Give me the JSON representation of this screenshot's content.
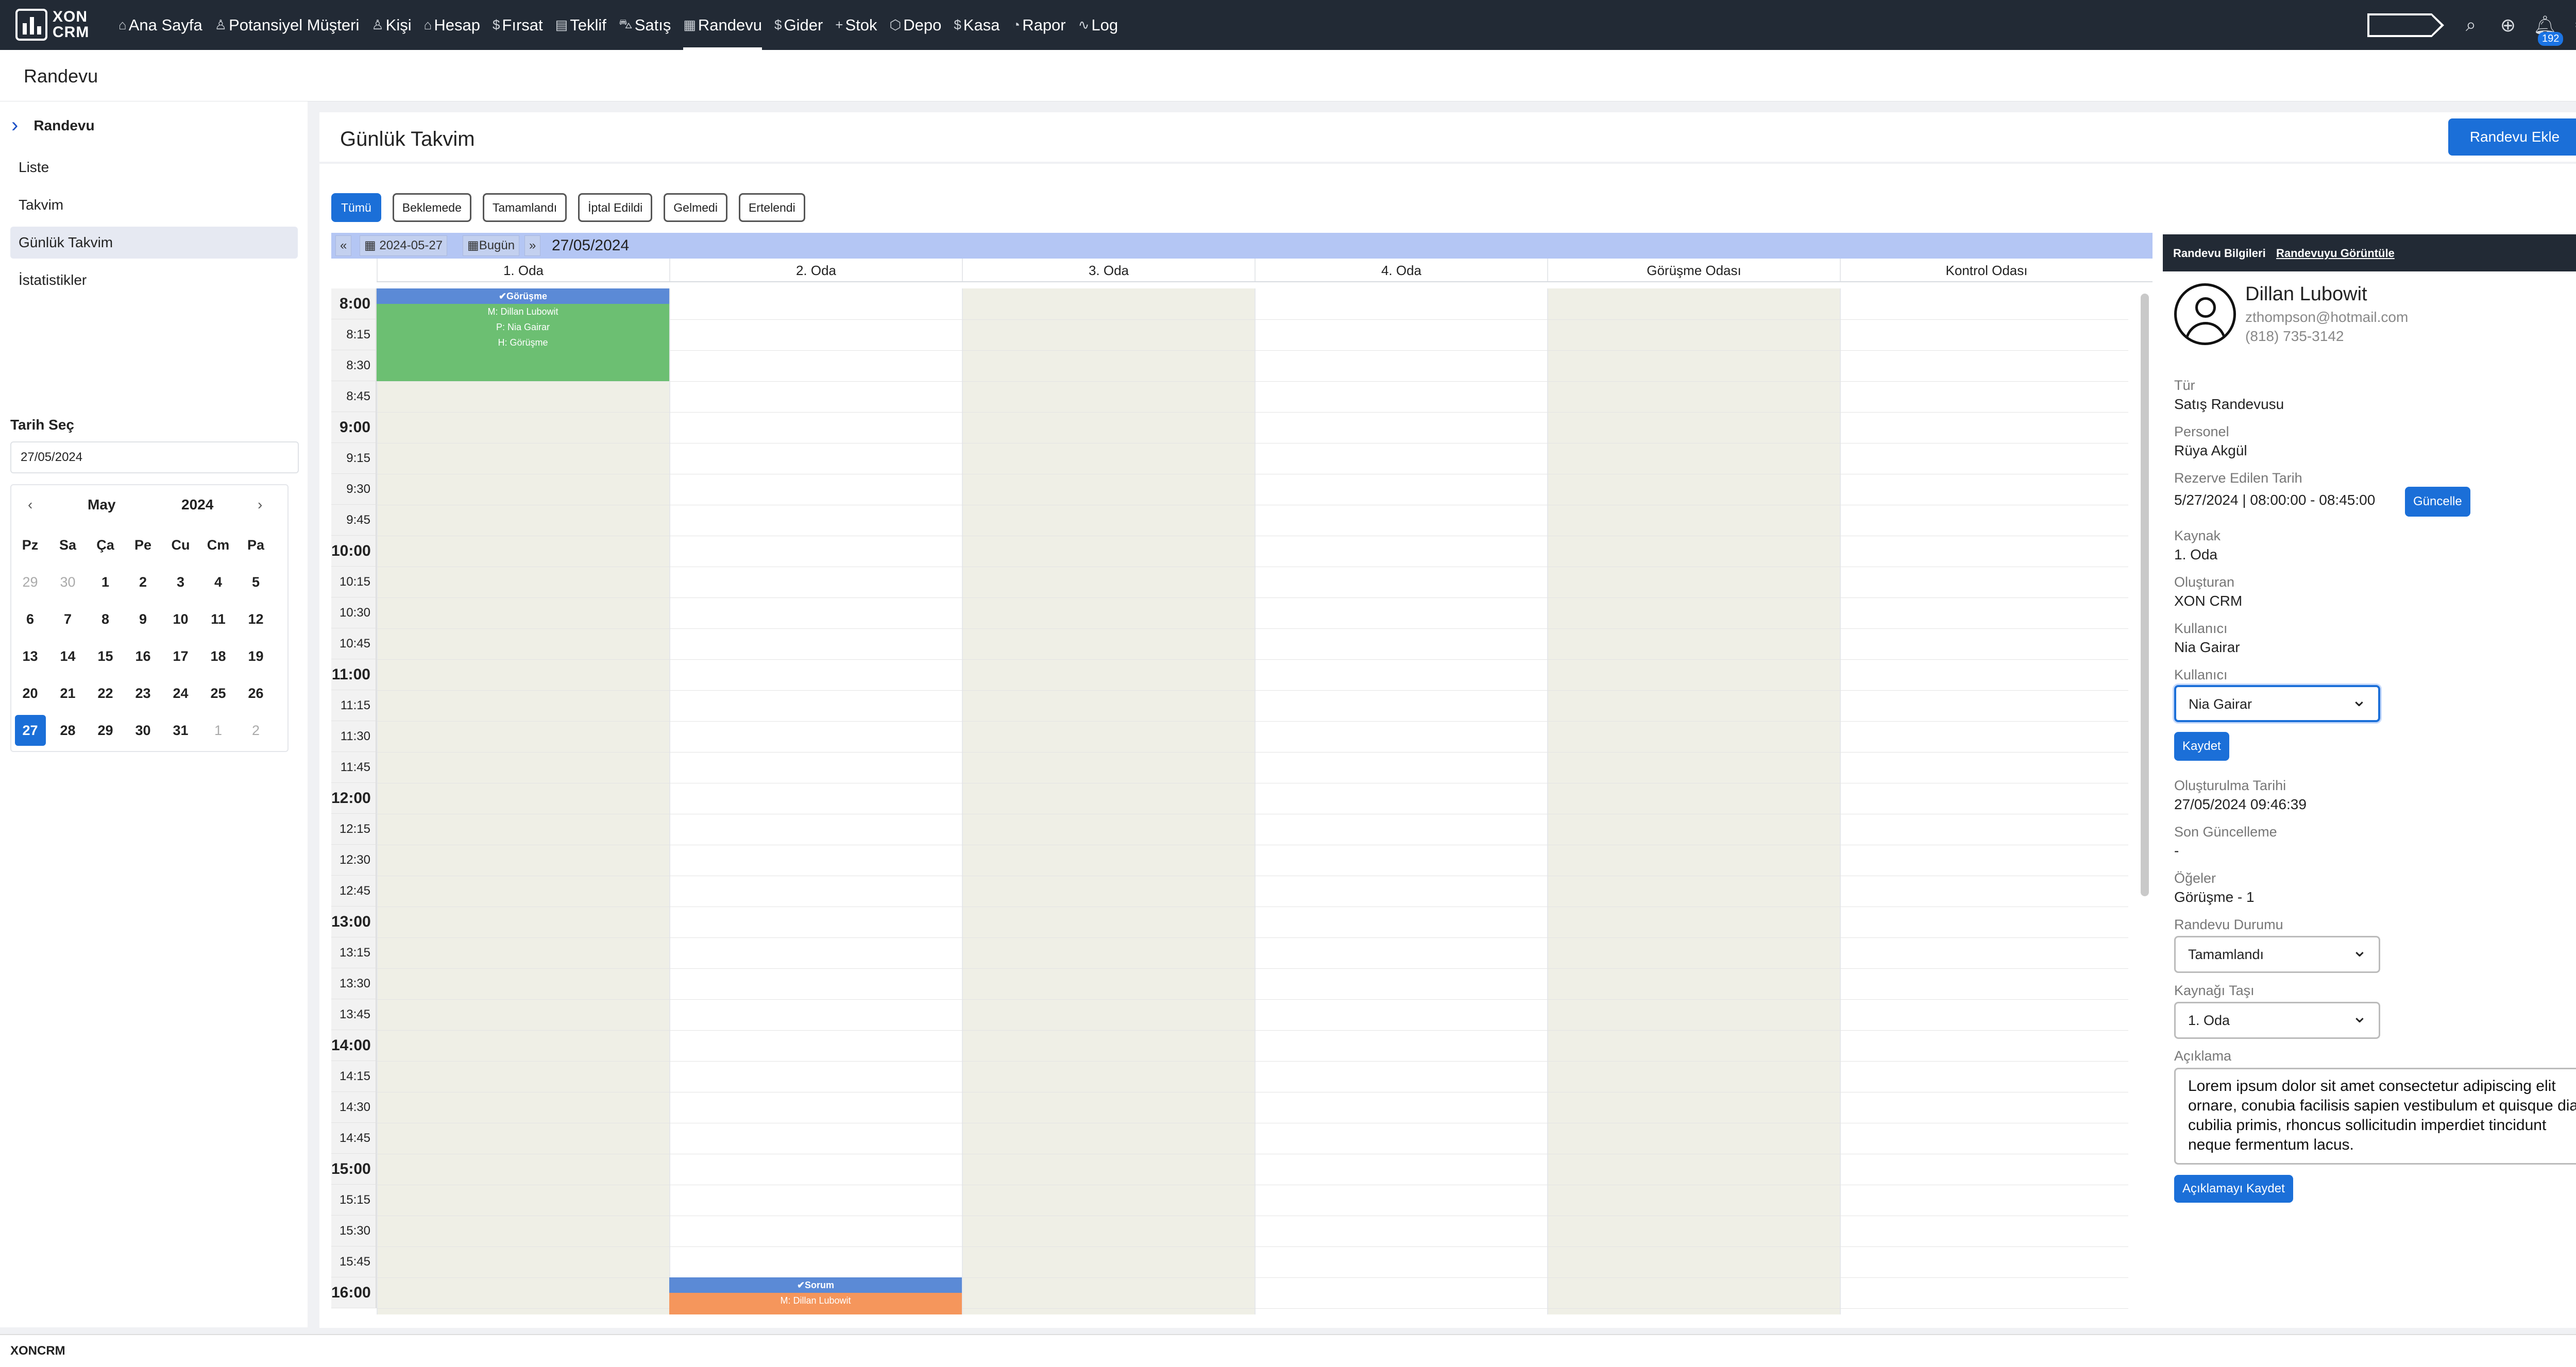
{
  "app": {
    "logo_line1": "XON",
    "logo_line2": "CRM",
    "notification_count": "192",
    "footer": "XONCRM"
  },
  "nav": [
    {
      "label": "Ana Sayfa",
      "icon": "home-icon",
      "glyph": "⌂"
    },
    {
      "label": "Potansiyel Müşteri",
      "icon": "user-icon",
      "glyph": "♙"
    },
    {
      "label": "Kişi",
      "icon": "users-icon",
      "glyph": "♙"
    },
    {
      "label": "Hesap",
      "icon": "home-icon",
      "glyph": "⌂"
    },
    {
      "label": "Fırsat",
      "icon": "dollar-icon",
      "glyph": "$"
    },
    {
      "label": "Teklif",
      "icon": "document-icon",
      "glyph": "▤"
    },
    {
      "label": "Satış",
      "icon": "cart-icon",
      "glyph": "⛍"
    },
    {
      "label": "Randevu",
      "icon": "calendar-icon",
      "glyph": "▦",
      "active": true
    },
    {
      "label": "Gider",
      "icon": "dollar-icon",
      "glyph": "$"
    },
    {
      "label": "Stok",
      "icon": "plus-icon",
      "glyph": "+"
    },
    {
      "label": "Depo",
      "icon": "box-icon",
      "glyph": "⬡"
    },
    {
      "label": "Kasa",
      "icon": "dollar-icon",
      "glyph": "$"
    },
    {
      "label": "Rapor",
      "icon": "chart-icon",
      "glyph": "◔"
    },
    {
      "label": "Log",
      "icon": "activity-icon",
      "glyph": "∿"
    }
  ],
  "page": {
    "title": "Randevu"
  },
  "sidebar": {
    "header": "Randevu",
    "items": [
      "Liste",
      "Takvim",
      "Günlük Takvim",
      "İstatistikler"
    ],
    "date_label": "Tarih Seç",
    "date_value": "27/05/2024",
    "calendar": {
      "month": "May",
      "year": "2024",
      "weekdays": [
        "Pz",
        "Sa",
        "Ça",
        "Pe",
        "Cu",
        "Cm",
        "Pa"
      ],
      "weeks": [
        [
          "29",
          "30",
          "1",
          "2",
          "3",
          "4",
          "5"
        ],
        [
          "6",
          "7",
          "8",
          "9",
          "10",
          "11",
          "12"
        ],
        [
          "13",
          "14",
          "15",
          "16",
          "17",
          "18",
          "19"
        ],
        [
          "20",
          "21",
          "22",
          "23",
          "24",
          "25",
          "26"
        ],
        [
          "27",
          "28",
          "29",
          "30",
          "31",
          "1",
          "2"
        ]
      ],
      "selected": "27"
    }
  },
  "main": {
    "title": "Günlük Takvim",
    "add_button": "Randevu Ekle",
    "filters": [
      "Tümü",
      "Beklemede",
      "Tamamlandı",
      "İptal Edildi",
      "Gelmedi",
      "Ertelendi"
    ]
  },
  "schedule": {
    "prev": "«",
    "date_picker": "2024-05-27",
    "today": "Bugün",
    "next": "»",
    "date_title": "27/05/2024",
    "rooms": [
      "1. Oda",
      "2. Oda",
      "3. Oda",
      "4. Oda",
      "Görüşme Odası",
      "Kontrol Odası"
    ],
    "times": [
      "8:00",
      "8:15",
      "8:30",
      "8:45",
      "9:00",
      "9:15",
      "9:30",
      "9:45",
      "10:00",
      "10:15",
      "10:30",
      "10:45",
      "11:00",
      "11:15",
      "11:30",
      "11:45",
      "12:00",
      "12:15",
      "12:30",
      "12:45",
      "13:00",
      "13:15",
      "13:30",
      "13:45",
      "14:00",
      "14:15",
      "14:30",
      "14:45",
      "15:00",
      "15:15",
      "15:30",
      "15:45",
      "16:00"
    ],
    "events": [
      {
        "title": "✔Görüşme",
        "lines": [
          "M: Dillan Lubowit",
          "P: Nia Gairar",
          "H: Görüşme"
        ],
        "color": "#6cbf72"
      },
      {
        "title": "✔Sorum",
        "lines": [
          "M: Dillan Lubowit"
        ],
        "color": "#f5965c"
      }
    ]
  },
  "detail": {
    "header_title": "Randevu Bilgileri",
    "header_link": "Randevuyu Görüntüle",
    "name": "Dillan Lubowit",
    "email": "zthompson@hotmail.com",
    "phone": "(818) 735-3142",
    "type_label": "Tür",
    "type_value": "Satış Randevusu",
    "staff_label": "Personel",
    "staff_value": "Rüya Akgül",
    "reserved_label": "Rezerve Edilen Tarih",
    "reserved_value": "5/27/2024 | 08:00:00 - 08:45:00",
    "update_button": "Güncelle",
    "source_label": "Kaynak",
    "source_value": "1. Oda",
    "creator_label": "Oluşturan",
    "creator_value": "XON CRM",
    "user_label": "Kullanıcı",
    "user_value": "Nia Gairar",
    "user_select_label": "Kullanıcı",
    "user_select_value": "Nia Gairar",
    "save_button": "Kaydet",
    "created_label": "Oluşturulma Tarihi",
    "created_value": "27/05/2024 09:46:39",
    "updated_label": "Son Güncelleme",
    "updated_value": "-",
    "items_label": "Öğeler",
    "items_value": "Görüşme - 1",
    "status_label": "Randevu Durumu",
    "status_value": "Tamamlandı",
    "move_label": "Kaynağı Taşı",
    "move_value": "1. Oda",
    "desc_label": "Açıklama",
    "desc_value": "Lorem ipsum dolor sit amet consectetur adipiscing elit ornare, conubia facilisis sapien vestibulum et quisque diam cubilia primis, rhoncus sollicitudin imperdiet tincidunt neque fermentum lacus.",
    "desc_button": "Açıklamayı Kaydet"
  }
}
